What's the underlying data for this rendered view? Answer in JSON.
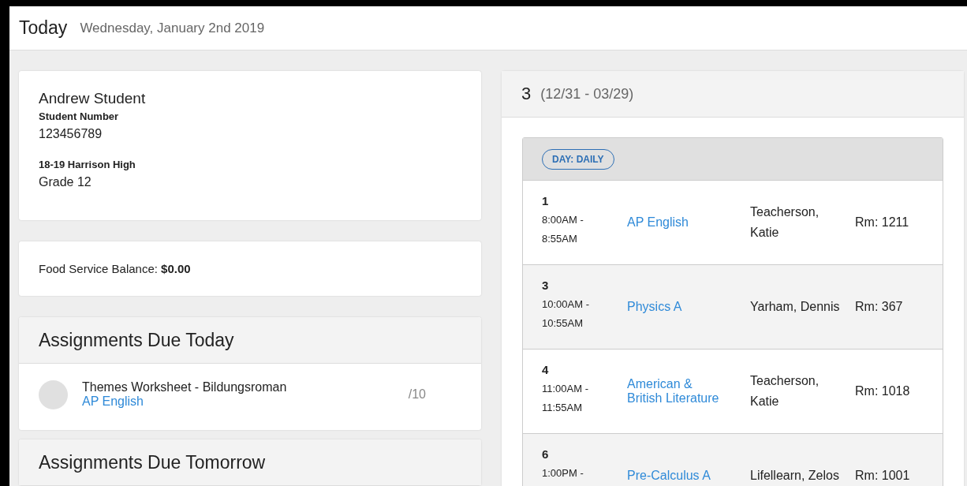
{
  "header": {
    "title": "Today",
    "date": "Wednesday, January 2nd 2019"
  },
  "student": {
    "name": "Andrew Student",
    "number_label": "Student Number",
    "number": "123456789",
    "school": "18-19 Harrison High",
    "grade": "Grade 12"
  },
  "food_service": {
    "text": "Food Service Balance: **$0.00**"
  },
  "assignments_today": {
    "title": "Assignments Due Today",
    "items": [
      {
        "name": "Themes Worksheet - Bildungsroman",
        "course": "AP English",
        "score": "/10"
      }
    ]
  },
  "assignments_tomorrow": {
    "title": "Assignments Due Tomorrow"
  },
  "term": {
    "number": "3",
    "dates": "(12/31 - 03/29)",
    "day_badge": "DAY: DAILY",
    "periods": [
      {
        "period": "1",
        "time": "8:00AM - 8:55AM",
        "course": "AP English",
        "teacher": "Teacherson, Katie",
        "room": "Rm: 1211"
      },
      {
        "period": "3",
        "time": "10:00AM - 10:55AM",
        "course": "Physics A",
        "teacher": "Yarham, Dennis",
        "room": "Rm: 367"
      },
      {
        "period": "4",
        "time": "11:00AM - 11:55AM",
        "course": "American & British Literature",
        "teacher": "Teacherson, Katie",
        "room": "Rm: 1018"
      },
      {
        "period": "6",
        "time": "1:00PM -",
        "course": "Pre-Calculus A",
        "teacher": "Lifellearn, Zelos",
        "room": "Rm: 1001"
      }
    ]
  }
}
